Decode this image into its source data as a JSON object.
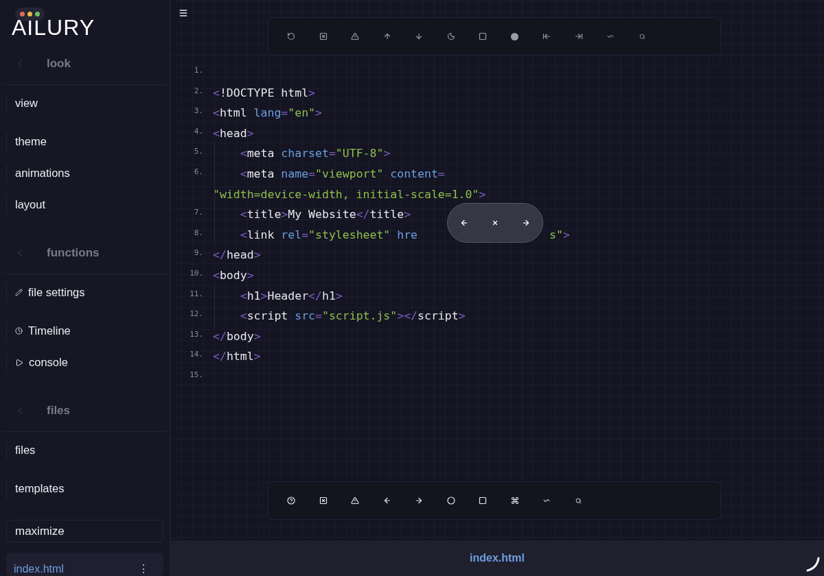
{
  "logo": "AILURY",
  "sidebar": {
    "sections": [
      {
        "title": "look",
        "items": [
          {
            "label": "view",
            "kind": "plain"
          },
          {
            "label": "theme",
            "kind": "plain"
          },
          {
            "label": "animations",
            "kind": "plain"
          },
          {
            "label": "layout",
            "kind": "plain"
          }
        ]
      },
      {
        "title": "functions",
        "items": [
          {
            "label": "file settings",
            "kind": "pencil"
          },
          {
            "label": "Timeline",
            "kind": "clock"
          },
          {
            "label": "console",
            "kind": "play"
          }
        ]
      },
      {
        "title": "files",
        "items": [
          {
            "label": "files",
            "kind": "plain"
          },
          {
            "label": "templates",
            "kind": "plain"
          }
        ]
      }
    ],
    "maximize": "maximize",
    "open_file": {
      "name": "index.html",
      "menu": "⋮"
    }
  },
  "top_toolbar": [
    {
      "kind": "undo"
    },
    {
      "kind": "closebox"
    },
    {
      "kind": "warning"
    },
    {
      "kind": "up"
    },
    {
      "kind": "down"
    },
    {
      "kind": "moon"
    },
    {
      "kind": "square"
    },
    {
      "kind": "dot"
    },
    {
      "kind": "toleft"
    },
    {
      "kind": "toright"
    },
    {
      "kind": "wave"
    },
    {
      "kind": "search"
    }
  ],
  "bottom_toolbar": [
    {
      "kind": "help"
    },
    {
      "kind": "closebox"
    },
    {
      "kind": "warning"
    },
    {
      "kind": "left"
    },
    {
      "kind": "right"
    },
    {
      "kind": "circle"
    },
    {
      "kind": "square"
    },
    {
      "kind": "command"
    },
    {
      "kind": "wave"
    },
    {
      "kind": "search"
    }
  ],
  "editor": {
    "lines": [
      {
        "number": "1."
      },
      {
        "number": "2.",
        "tokens": [
          {
            "kind": "punct",
            "text": "<"
          },
          {
            "kind": "tag",
            "text": "!DOCTYPE html"
          },
          {
            "kind": "punct",
            "text": ">"
          }
        ]
      },
      {
        "number": "3.",
        "tokens": [
          {
            "kind": "punct",
            "text": "<"
          },
          {
            "kind": "tag",
            "text": "html "
          },
          {
            "kind": "attr",
            "text": "lang"
          },
          {
            "kind": "punct",
            "text": "="
          },
          {
            "kind": "string",
            "text": "\"en\""
          },
          {
            "kind": "punct",
            "text": ">"
          }
        ]
      },
      {
        "number": "4.",
        "tokens": [
          {
            "kind": "punct",
            "text": "<"
          },
          {
            "kind": "tag",
            "text": "head"
          },
          {
            "kind": "punct",
            "text": ">"
          }
        ]
      },
      {
        "number": "5.",
        "tokens": [
          {
            "kind": "punct",
            "text": "    <"
          },
          {
            "kind": "tag",
            "text": "meta "
          },
          {
            "kind": "attr",
            "text": "charset"
          },
          {
            "kind": "punct",
            "text": "="
          },
          {
            "kind": "string",
            "text": "\"UTF-8\""
          },
          {
            "kind": "punct",
            "text": ">"
          }
        ]
      },
      {
        "number": "6.",
        "tokens": [
          {
            "kind": "punct",
            "text": "    <"
          },
          {
            "kind": "tag",
            "text": "meta "
          },
          {
            "kind": "attr",
            "text": "name"
          },
          {
            "kind": "punct",
            "text": "="
          },
          {
            "kind": "string",
            "text": "\"viewport\""
          },
          {
            "kind": "attr",
            "text": " content"
          },
          {
            "kind": "punct",
            "text": "="
          },
          {
            "kind": "break"
          },
          {
            "kind": "string",
            "text": "\"width=device-width, initial-scale=1.0\""
          },
          {
            "kind": "punct",
            "text": ">"
          }
        ]
      },
      {
        "number": "7.",
        "tokens": [
          {
            "kind": "punct",
            "text": "    <"
          },
          {
            "kind": "tag",
            "text": "title"
          },
          {
            "kind": "punct",
            "text": ">"
          },
          {
            "kind": "tag",
            "text": "My Website"
          },
          {
            "kind": "punct",
            "text": "</"
          },
          {
            "kind": "tag",
            "text": "title"
          },
          {
            "kind": "punct",
            "text": ">"
          }
        ]
      },
      {
        "number": "8.",
        "tokens": [
          {
            "kind": "punct",
            "text": "    <"
          },
          {
            "kind": "tag",
            "text": "link "
          },
          {
            "kind": "attr",
            "text": "rel"
          },
          {
            "kind": "punct",
            "text": "="
          },
          {
            "kind": "string",
            "text": "\"stylesheet\""
          },
          {
            "kind": "attr",
            "text": " hre"
          },
          {
            "kind": "gap"
          },
          {
            "kind": "string",
            "text": "s\""
          },
          {
            "kind": "punct",
            "text": ">"
          }
        ]
      },
      {
        "number": "9.",
        "tokens": [
          {
            "kind": "punct",
            "text": "</"
          },
          {
            "kind": "tag",
            "text": "head"
          },
          {
            "kind": "punct",
            "text": ">"
          }
        ]
      },
      {
        "number": "10.",
        "tokens": [
          {
            "kind": "punct",
            "text": "<"
          },
          {
            "kind": "tag",
            "text": "body"
          },
          {
            "kind": "punct",
            "text": ">"
          }
        ]
      },
      {
        "number": "11.",
        "tokens": [
          {
            "kind": "punct",
            "text": "    <"
          },
          {
            "kind": "tag",
            "text": "h1"
          },
          {
            "kind": "punct",
            "text": ">"
          },
          {
            "kind": "tag",
            "text": "Header"
          },
          {
            "kind": "punct",
            "text": "</"
          },
          {
            "kind": "tag",
            "text": "h1"
          },
          {
            "kind": "punct",
            "text": ">"
          }
        ]
      },
      {
        "number": "12.",
        "tokens": [
          {
            "kind": "punct",
            "text": "    <"
          },
          {
            "kind": "tag",
            "text": "script "
          },
          {
            "kind": "attr",
            "text": "src"
          },
          {
            "kind": "punct",
            "text": "="
          },
          {
            "kind": "string",
            "text": "\"script.js\""
          },
          {
            "kind": "punct",
            "text": "></"
          },
          {
            "kind": "tag",
            "text": "script"
          },
          {
            "kind": "punct",
            "text": ">"
          }
        ]
      },
      {
        "number": "13.",
        "tokens": [
          {
            "kind": "punct",
            "text": "</"
          },
          {
            "kind": "tag",
            "text": "body"
          },
          {
            "kind": "punct",
            "text": ">"
          }
        ]
      },
      {
        "number": "14.",
        "tokens": [
          {
            "kind": "punct",
            "text": "</"
          },
          {
            "kind": "tag",
            "text": "html"
          },
          {
            "kind": "punct",
            "text": ">"
          }
        ]
      },
      {
        "number": "15."
      }
    ]
  },
  "status_bar": {
    "file": "index.html"
  }
}
